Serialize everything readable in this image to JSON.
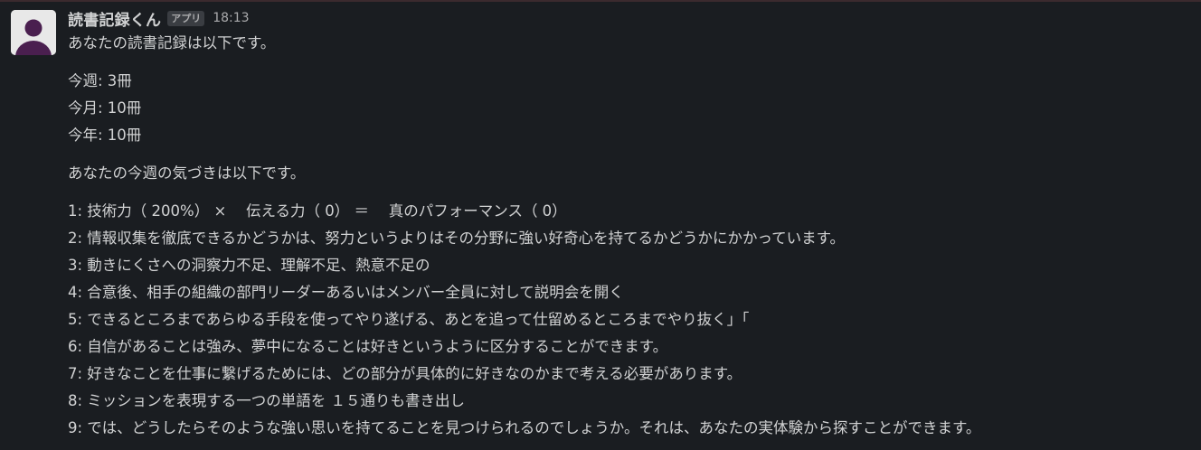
{
  "message": {
    "sender": "読書記録くん",
    "badge": "アプリ",
    "time": "18:13",
    "intro": "あなたの読書記録は以下です。",
    "stats": [
      "今週: 3冊",
      "今月: 10冊",
      "今年: 10冊"
    ],
    "insight_intro": "あなたの今週の気づきは以下です。",
    "insights": [
      "1: 技術力（ 200%） ×　 伝える力（ 0） ＝　 真のパフォーマンス（ 0）",
      "2: 情報収集を徹底できるかどうかは、努力というよりはその分野に強い好奇心を持てるかどうかにかかっています。",
      "3: 動きにくさへの洞察力不足、理解不足、熱意不足の",
      "4: 合意後、相手の組織の部門リーダーあるいはメンバー全員に対して説明会を開く",
      "5: できるところまであらゆる手段を使ってやり遂げる、あとを追って仕留めるところまでやり抜く」「",
      "6: 自信があることは強み、夢中になることは好きというように区分することができます。",
      "7: 好きなことを仕事に繋げるためには、どの部分が具体的に好きなのかまで考える必要があります。",
      "8: ミッションを表現する一つの単語を １５通りも書き出し",
      "9: では、どうしたらそのような強い思いを持てることを見つけられるのでしょうか。それは、あなたの実体験から探すことができます。"
    ]
  },
  "avatar": {
    "icon": "default-user-icon",
    "bg_color": "#e8e8e8",
    "fg_color": "#4a1f4f"
  }
}
